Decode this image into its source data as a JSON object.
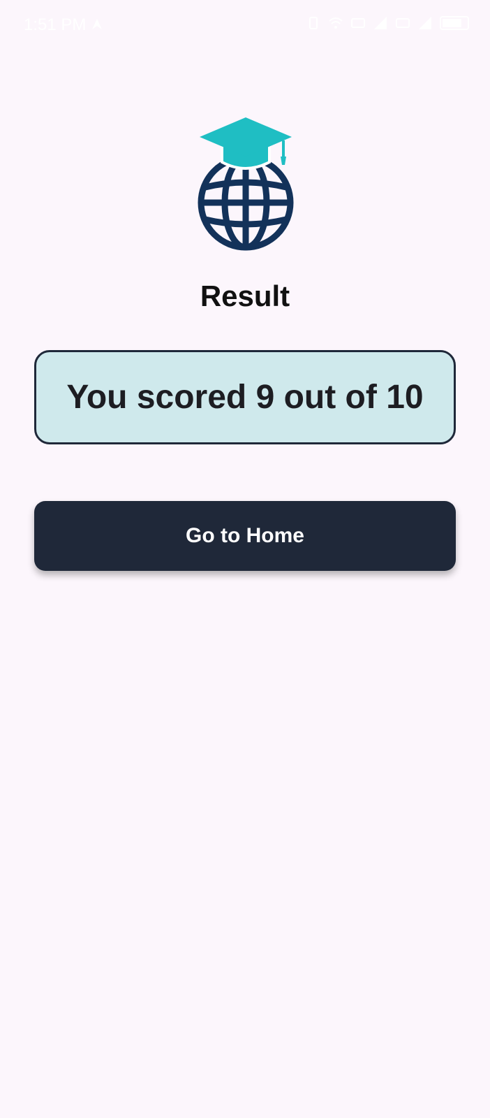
{
  "status_bar": {
    "time": "1:51 PM",
    "icons": [
      "navigation-icon",
      "vibrate-icon",
      "wifi-icon",
      "volte-icon",
      "signal-icon",
      "volte-2-icon",
      "signal-2-icon",
      "battery-icon"
    ]
  },
  "logo": {
    "icon": "globe-graduation-cap-icon",
    "colors": {
      "cap": "#1fbec3",
      "globe": "#13325a"
    }
  },
  "result": {
    "title": "Result",
    "score_text": "You scored 9 out of 10",
    "score_box_bg": "#cfe9ec"
  },
  "actions": {
    "home_label": "Go to Home",
    "button_bg": "#1f2839"
  },
  "theme": {
    "background": "#fcf6fc"
  }
}
